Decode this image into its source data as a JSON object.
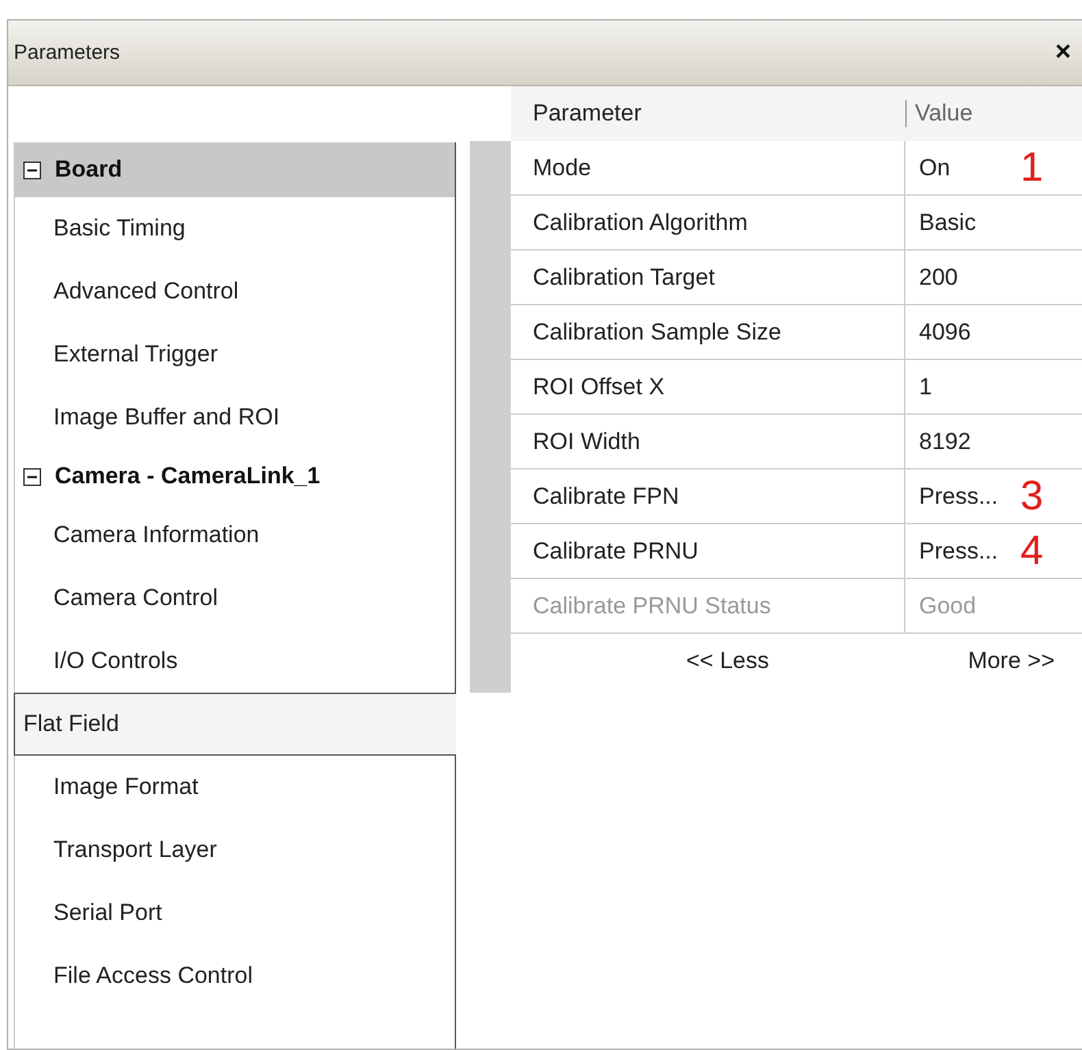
{
  "window": {
    "title": "Parameters",
    "close": "×"
  },
  "sidebar": {
    "groups": [
      {
        "label": "Board",
        "expanded": true,
        "selected": true,
        "children": [
          {
            "label": "Basic Timing",
            "selected": false
          },
          {
            "label": "Advanced Control",
            "selected": false
          },
          {
            "label": "External Trigger",
            "selected": false
          },
          {
            "label": "Image Buffer and ROI",
            "selected": false
          }
        ]
      },
      {
        "label": "Camera - CameraLink_1",
        "expanded": true,
        "selected": false,
        "children": [
          {
            "label": "Camera Information",
            "selected": false
          },
          {
            "label": "Camera Control",
            "selected": false
          },
          {
            "label": "I/O Controls",
            "selected": false
          },
          {
            "label": "Flat Field",
            "selected": true
          },
          {
            "label": "Image Format",
            "selected": false
          },
          {
            "label": "Transport Layer",
            "selected": false
          },
          {
            "label": "Serial Port",
            "selected": false
          },
          {
            "label": "File Access Control",
            "selected": false
          }
        ]
      }
    ]
  },
  "table": {
    "columns": [
      "Parameter",
      "Value"
    ],
    "rows": [
      {
        "parameter": "Mode",
        "value": "On",
        "disabled": false,
        "annotation": "1"
      },
      {
        "parameter": "Calibration Algorithm",
        "value": "Basic",
        "disabled": false
      },
      {
        "parameter": "Calibration Target",
        "value": "200",
        "disabled": false
      },
      {
        "parameter": "Calibration Sample Size",
        "value": "4096",
        "disabled": false
      },
      {
        "parameter": "ROI Offset X",
        "value": "1",
        "disabled": false
      },
      {
        "parameter": "ROI Width",
        "value": "8192",
        "disabled": false
      },
      {
        "parameter": "Calibrate FPN",
        "value": "Press...",
        "disabled": false,
        "annotation": "3"
      },
      {
        "parameter": "Calibrate PRNU",
        "value": "Press...",
        "disabled": false,
        "annotation": "4"
      },
      {
        "parameter": "Calibrate PRNU Status",
        "value": "Good",
        "disabled": true
      }
    ],
    "footer_buttons": [
      "<< Less",
      "More >>"
    ]
  }
}
